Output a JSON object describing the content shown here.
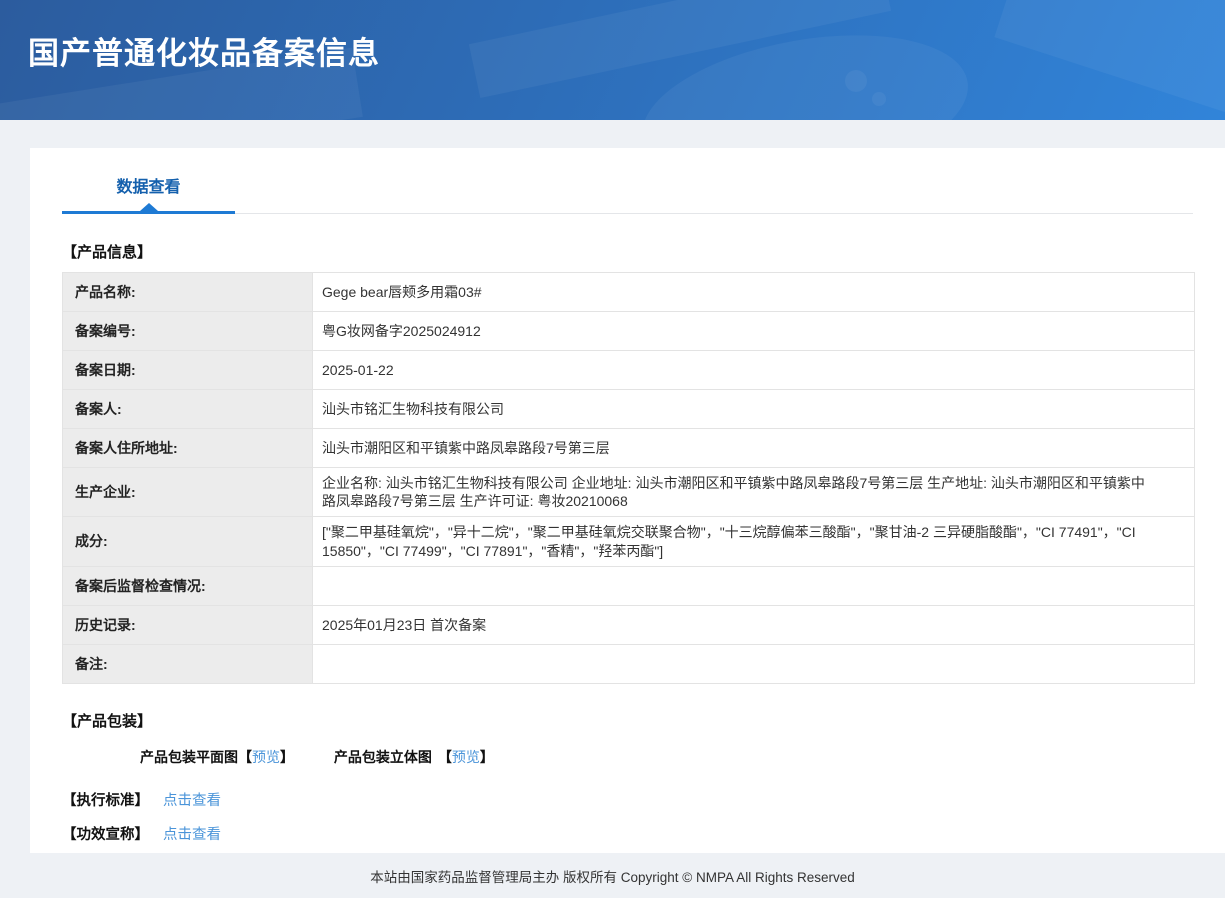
{
  "banner": {
    "title": "国产普通化妆品备案信息"
  },
  "tabs": {
    "data_view": "数据查看"
  },
  "sections": {
    "product_info": "【产品信息】",
    "packaging": "【产品包装】",
    "standard": "【执行标准】",
    "efficacy": "【功效宣称】"
  },
  "table": {
    "rows": [
      {
        "label": "产品名称:",
        "value": "Gege bear唇颊多用霜03#"
      },
      {
        "label": "备案编号:",
        "value": "粤G妆网备字2025024912"
      },
      {
        "label": "备案日期:",
        "value": "2025-01-22"
      },
      {
        "label": "备案人:",
        "value": "汕头市铭汇生物科技有限公司"
      },
      {
        "label": "备案人住所地址:",
        "value": "汕头市潮阳区和平镇紫中路凤皋路段7号第三层"
      },
      {
        "label": "生产企业:",
        "value": "企业名称: 汕头市铭汇生物科技有限公司 企业地址: 汕头市潮阳区和平镇紫中路凤皋路段7号第三层 生产地址: 汕头市潮阳区和平镇紫中路凤皋路段7号第三层 生产许可证: 粤妆20210068"
      },
      {
        "label": "成分:",
        "value": "[\"聚二甲基硅氧烷\"，\"异十二烷\"，\"聚二甲基硅氧烷交联聚合物\"，\"十三烷醇偏苯三酸酯\"，\"聚甘油-2 三异硬脂酸酯\"，\"CI 77491\"，\"CI 15850\"，\"CI 77499\"，\"CI 77891\"，\"香精\"，\"羟苯丙酯\"]"
      },
      {
        "label": "备案后监督检查情况:",
        "value": ""
      },
      {
        "label": "历史记录:",
        "value": "2025年01月23日 首次备案"
      },
      {
        "label": "备注:",
        "value": ""
      }
    ]
  },
  "packaging": {
    "flat_label": "产品包装平面图",
    "stereo_label": "产品包装立体图",
    "preview_link": "预览",
    "bracket_open": "【",
    "bracket_close": "】"
  },
  "links": {
    "click_view": "点击查看"
  },
  "footer": {
    "copyright": "本站由国家药品监督管理局主办 版权所有 Copyright © NMPA All Rights Reserved"
  },
  "colors": {
    "banner_top": "#2c5c9e",
    "banner_bottom": "#3184d9",
    "tab_accent": "#1e7ad4",
    "tab_text": "#1460ad",
    "link_blue": "#4a94d9",
    "label_cell_bg": "#ececec",
    "table_border": "#a9c3e3",
    "page_bg": "#eef1f5"
  }
}
